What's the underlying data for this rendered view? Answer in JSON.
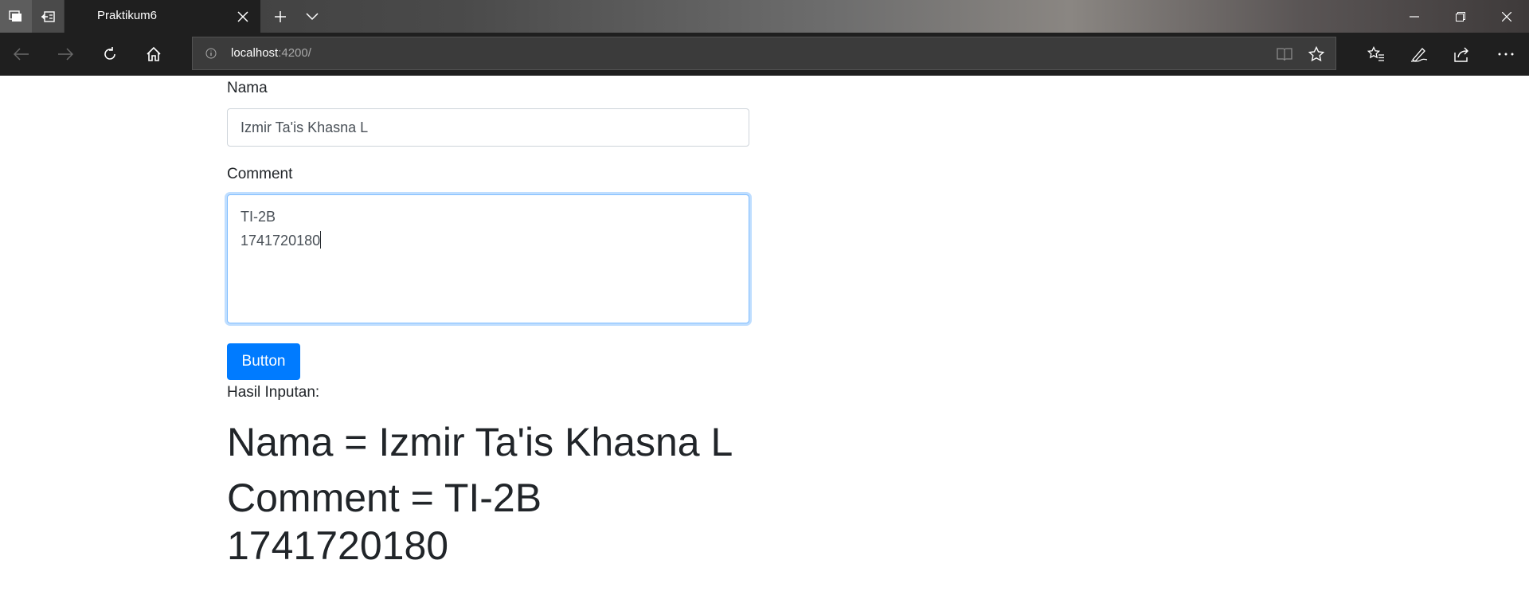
{
  "browser": {
    "tab_title": "Praktikum6",
    "url_host": "localhost",
    "url_rest": ":4200/"
  },
  "form": {
    "nama_label": "Nama",
    "nama_value": "Izmir Ta'is Khasna L",
    "comment_label": "Comment",
    "comment_line1": "TI-2B",
    "comment_line2": "1741720180",
    "button_label": "Button"
  },
  "result": {
    "heading": "Hasil Inputan:",
    "nama_prefix": "Nama = ",
    "nama_value": "Izmir Ta'is Khasna L",
    "comment_prefix": "Comment = ",
    "comment_line1": "TI-2B",
    "comment_line2": "1741720180"
  },
  "colors": {
    "primary": "#007bff",
    "text": "#212529",
    "chrome_dark": "#1f1f1f"
  }
}
